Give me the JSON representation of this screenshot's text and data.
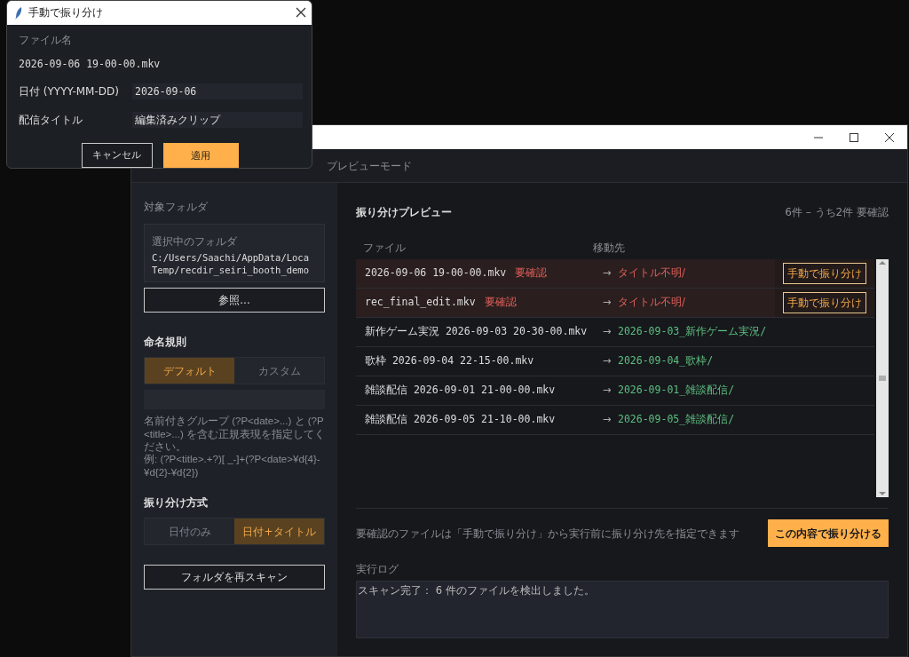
{
  "dialog": {
    "title": "手動で振り分け",
    "filename_label": "ファイル名",
    "filename": "2026-09-06 19-00-00.mkv",
    "fields": [
      {
        "label": "日付 (YYYY-MM-DD)",
        "value": "2026-09-06",
        "kind": "mono"
      },
      {
        "label": "配信タイトル",
        "value": "編集済みクリップ",
        "kind": "text"
      }
    ],
    "buttons": [
      {
        "label": "キャンセル",
        "kind": "secondary"
      },
      {
        "label": "適用",
        "kind": "primary"
      }
    ]
  },
  "window": {
    "subtitle": "プレビューモード"
  },
  "sidebar": {
    "folder_heading": "対象フォルダ",
    "folder_box_label": "選択中のフォルダ",
    "folder_path": [
      "C:/Users/Saachi/AppData/Loca",
      "Temp/recdir_seiri_booth_demo"
    ],
    "browse_button": "参照...",
    "naming_heading": "命名規則",
    "naming_options": [
      {
        "label": "デフォルト",
        "selected": true
      },
      {
        "label": "カスタム",
        "selected": false
      }
    ],
    "naming_help": [
      "名前付きグループ (?P<date>...) と (?P<title>...) を含む正規表現を指定してください。",
      "例: (?P<title>.+?)[ _-]+(?P<date>¥d{4}-¥d{2}-¥d{2})"
    ],
    "method_heading": "振り分け方式",
    "method_options": [
      {
        "label": "日付のみ",
        "selected": false
      },
      {
        "label": "日付+タイトル",
        "selected": true
      }
    ],
    "rescan_button": "フォルダを再スキャン"
  },
  "preview": {
    "title": "振り分けプレビュー",
    "summary": "6件 – うち2件 要確認",
    "columns": [
      "ファイル",
      "移動先"
    ],
    "rows": [
      {
        "file": "2026-09-06 19-00-00.mkv",
        "needs_review": true,
        "status": "要確認",
        "arrow": "→",
        "dest": "タイトル不明/",
        "action": "手動で振り分け"
      },
      {
        "file": "rec_final_edit.mkv",
        "needs_review": true,
        "status": "要確認",
        "arrow": "→",
        "dest": "タイトル不明/",
        "action": "手動で振り分け"
      },
      {
        "file": "新作ゲーム実況 2026-09-03 20-30-00.mkv",
        "needs_review": false,
        "arrow": "→",
        "dest": "2026-09-03_新作ゲーム実況/"
      },
      {
        "file": "歌枠 2026-09-04 22-15-00.mkv",
        "needs_review": false,
        "arrow": "→",
        "dest": "2026-09-04_歌枠/"
      },
      {
        "file": "雑談配信 2026-09-01 21-00-00.mkv",
        "needs_review": false,
        "arrow": "→",
        "dest": "2026-09-01_雑談配信/"
      },
      {
        "file": "雑談配信 2026-09-05 21-10-00.mkv",
        "needs_review": false,
        "arrow": "→",
        "dest": "2026-09-05_雑談配信/"
      }
    ],
    "note": "要確認のファイルは「手動で振り分け」から実行前に振り分け先を指定できます",
    "run_button": "この内容で振り分ける",
    "log_label": "実行ログ",
    "log": "スキャン完了： 6 件のファイルを検出しました。"
  }
}
